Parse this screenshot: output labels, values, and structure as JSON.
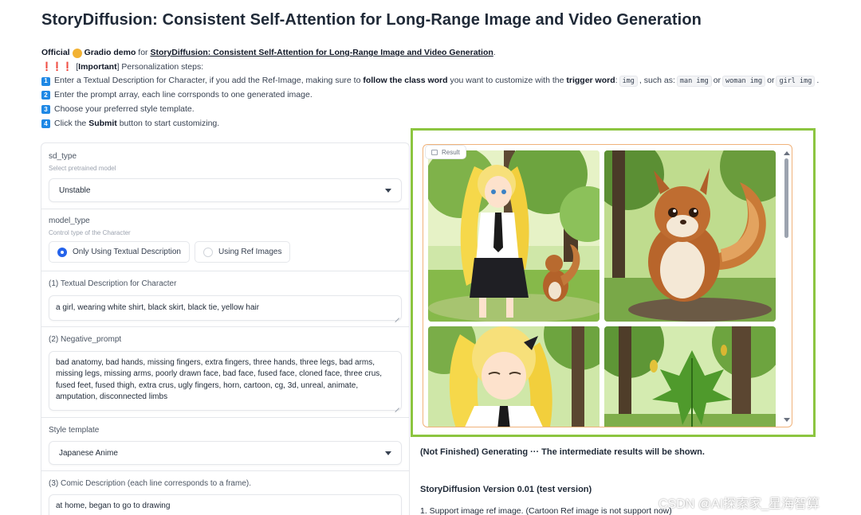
{
  "title": "StoryDiffusion: Consistent Self-Attention for Long-Range Image and Video Generation",
  "intro": {
    "official": "Official",
    "gradio_demo": "Gradio demo",
    "for_text": "for",
    "paper_link": "StoryDiffusion: Consistent Self-Attention for Long-Range Image and Video Generation",
    "period": ".",
    "important_marks": "❗❗❗",
    "important_open": "[",
    "important_word": "Important",
    "important_close": "] Personalization steps:",
    "steps": [
      {
        "num": "1",
        "pre": "Enter a Textual Description for Character, if you add the Ref-Image, making sure to",
        "bold1": "follow the class word",
        "mid": "you want to customize with the",
        "bold2": "trigger word",
        "colon": ":",
        "code_trigger": "img",
        "such_as": ", such as:",
        "ex1": "man img",
        "or1": "or",
        "ex2": "woman img",
        "or2": "or",
        "ex3": "girl img",
        "end": "."
      },
      {
        "num": "2",
        "text": "Enter the prompt array, each line corrsponds to one generated image."
      },
      {
        "num": "3",
        "text": "Choose your preferred style template."
      },
      {
        "num": "4",
        "pre": "Click the",
        "bold": "Submit",
        "post": "button to start customizing."
      }
    ]
  },
  "sd_type": {
    "label": "sd_type",
    "sub": "Select pretrained model",
    "value": "Unstable"
  },
  "model_type": {
    "label": "model_type",
    "sub": "Control type of the Character",
    "options": [
      "Only Using Textual Description",
      "Using Ref Images"
    ],
    "selected": "Only Using Textual Description"
  },
  "character": {
    "label": "(1) Textual Description for Character",
    "value": "a girl, wearing white shirt, black skirt, black tie, yellow hair"
  },
  "negative": {
    "label": "(2) Negative_prompt",
    "lines": [
      "bad anatomy, bad hands, missing fingers, extra fingers, three hands, three legs, bad arms,",
      "missing legs, missing arms, poorly drawn face, bad face, fused face, cloned face, three crus,",
      "fused feet, fused thigh, extra crus, ugly fingers, horn, cartoon, cg, 3d, unreal, animate,",
      "amputation, disconnected limbs"
    ]
  },
  "style": {
    "label": "Style template",
    "value": "Japanese Anime"
  },
  "comic": {
    "label": "(3) Comic Description (each line corresponds to a frame).",
    "value": "at home, began to go to drawing"
  },
  "result": {
    "label": "Result",
    "images": [
      {
        "name": "girl-with-squirrel-image"
      },
      {
        "name": "squirrel-closeup-image"
      },
      {
        "name": "girl-portrait-image"
      },
      {
        "name": "leaf-in-forest-image"
      }
    ]
  },
  "status": "(Not Finished) Generating ···  The intermediate results will be shown.",
  "version": "StoryDiffusion Version 0.01 (test version)",
  "feature_1": "1. Support image ref image. (Cartoon Ref image is not support now)",
  "watermark": "CSDN @AI探索家_星海智算",
  "colors": {
    "accent": "#2563eb",
    "highlight_frame": "#8cc540",
    "result_border": "#f0b27a",
    "step_badge": "#1e88e5"
  }
}
